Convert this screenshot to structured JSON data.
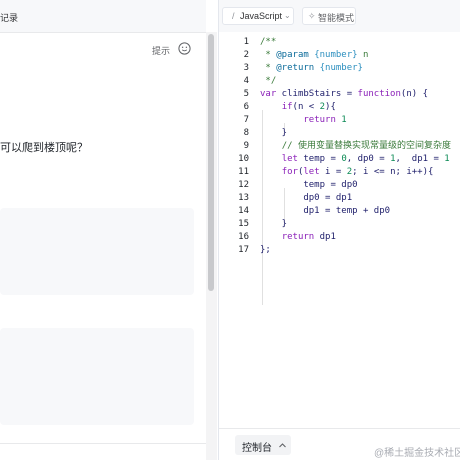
{
  "left_panel": {
    "tab_label": "记录",
    "hint_label": "提示",
    "question_text": "可以爬到楼顶呢？"
  },
  "editor_toolbar": {
    "language": "JavaScript",
    "mode_label": "智能模式"
  },
  "code_lines": [
    {
      "no": "1",
      "segs": [
        [
          "c-comment",
          "/**"
        ]
      ]
    },
    {
      "no": "2",
      "segs": [
        [
          "c-comment",
          " * "
        ],
        [
          "c-tag",
          "@param"
        ],
        [
          "c-comment",
          " "
        ],
        [
          "c-type",
          "{number}"
        ],
        [
          "c-comment",
          " n"
        ]
      ]
    },
    {
      "no": "3",
      "segs": [
        [
          "c-comment",
          " * "
        ],
        [
          "c-tag",
          "@return"
        ],
        [
          "c-comment",
          " "
        ],
        [
          "c-type",
          "{number}"
        ]
      ]
    },
    {
      "no": "4",
      "segs": [
        [
          "c-comment",
          " */"
        ]
      ]
    },
    {
      "no": "5",
      "segs": [
        [
          "c-kw",
          "var"
        ],
        [
          "c-id",
          " climbStairs = "
        ],
        [
          "c-kw",
          "function"
        ],
        [
          "c-id",
          "(n) {"
        ]
      ]
    },
    {
      "no": "6",
      "segs": [
        [
          "c-id",
          "    "
        ],
        [
          "c-kw",
          "if"
        ],
        [
          "c-id",
          "(n < "
        ],
        [
          "c-num",
          "2"
        ],
        [
          "c-id",
          "){"
        ]
      ]
    },
    {
      "no": "7",
      "segs": [
        [
          "c-id",
          "        "
        ],
        [
          "c-kw",
          "return"
        ],
        [
          "c-id",
          " "
        ],
        [
          "c-num",
          "1"
        ]
      ]
    },
    {
      "no": "8",
      "segs": [
        [
          "c-id",
          "    }"
        ]
      ]
    },
    {
      "no": "9",
      "segs": [
        [
          "c-id",
          "    "
        ],
        [
          "c-comment",
          "// 使用变量替换实现常量级的空间复杂度"
        ]
      ]
    },
    {
      "no": "10",
      "segs": [
        [
          "c-id",
          "    "
        ],
        [
          "c-kw",
          "let"
        ],
        [
          "c-id",
          " temp = "
        ],
        [
          "c-num",
          "0"
        ],
        [
          "c-id",
          ", dp0 = "
        ],
        [
          "c-num",
          "1"
        ],
        [
          "c-id",
          ",  dp1 = "
        ],
        [
          "c-num",
          "1"
        ]
      ]
    },
    {
      "no": "11",
      "segs": [
        [
          "c-id",
          "    "
        ],
        [
          "c-kw",
          "for"
        ],
        [
          "c-id",
          "("
        ],
        [
          "c-kw",
          "let"
        ],
        [
          "c-id",
          " i = "
        ],
        [
          "c-num",
          "2"
        ],
        [
          "c-id",
          "; i <= n; i++){"
        ]
      ]
    },
    {
      "no": "12",
      "segs": [
        [
          "c-id",
          "        temp = dp0"
        ]
      ]
    },
    {
      "no": "13",
      "segs": [
        [
          "c-id",
          "        dp0 = dp1"
        ]
      ]
    },
    {
      "no": "14",
      "segs": [
        [
          "c-id",
          "        dp1 = temp + dp0"
        ]
      ]
    },
    {
      "no": "15",
      "segs": [
        [
          "c-id",
          "    }"
        ]
      ]
    },
    {
      "no": "16",
      "segs": [
        [
          "c-id",
          "    "
        ],
        [
          "c-kw",
          "return"
        ],
        [
          "c-id",
          " dp1"
        ]
      ]
    },
    {
      "no": "17",
      "segs": [
        [
          "c-id",
          "};"
        ]
      ]
    }
  ],
  "console": {
    "label": "控制台",
    "toggle_icon": "chevron-up-icon"
  },
  "watermark": "@稀土掘金技术社区"
}
